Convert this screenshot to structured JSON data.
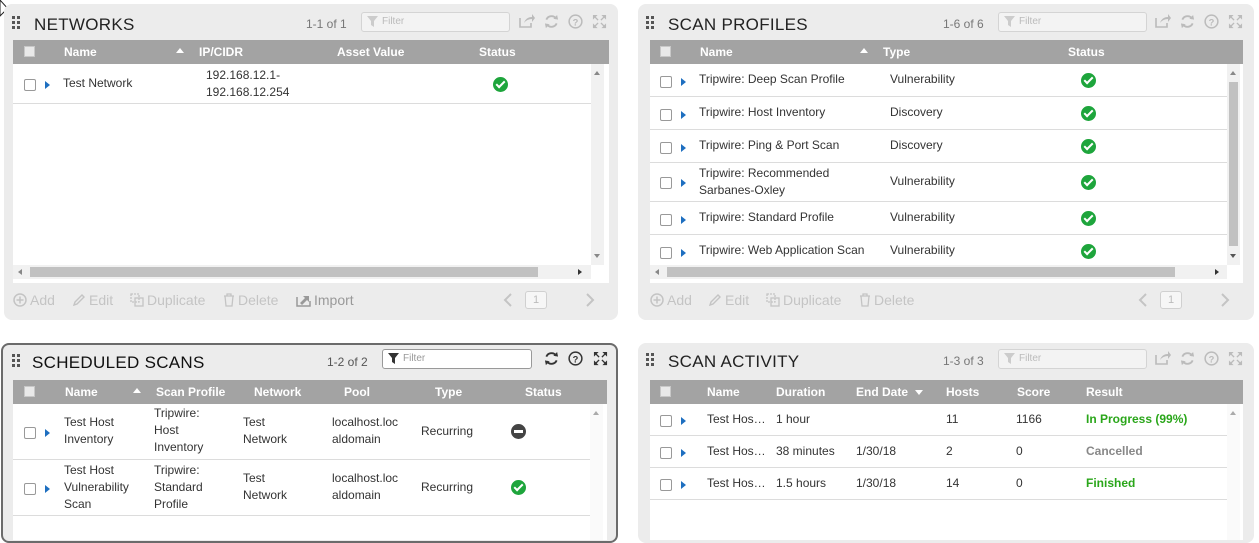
{
  "networks": {
    "title": "NETWORKS",
    "count": "1-1 of 1",
    "filter_placeholder": "Filter",
    "columns": [
      "Name",
      "IP/CIDR",
      "Asset Value",
      "Status"
    ],
    "rows": [
      {
        "name": "Test Network",
        "ip_line1": "192.168.12.1-",
        "ip_line2": "192.168.12.254",
        "asset_value": "",
        "status": "ok"
      }
    ],
    "footer": {
      "add": "Add",
      "edit": "Edit",
      "duplicate": "Duplicate",
      "delete": "Delete",
      "import": "Import"
    },
    "page": "1"
  },
  "scan_profiles": {
    "title": "SCAN PROFILES",
    "count": "1-6 of 6",
    "filter_placeholder": "Filter",
    "columns": [
      "Name",
      "Type",
      "Status"
    ],
    "rows": [
      {
        "name_line1": "Tripwire: Deep Scan Profile",
        "name_line2": "",
        "type": "Vulnerability",
        "status": "ok"
      },
      {
        "name_line1": "Tripwire: Host Inventory",
        "name_line2": "",
        "type": "Discovery",
        "status": "ok"
      },
      {
        "name_line1": "Tripwire: Ping & Port Scan",
        "name_line2": "",
        "type": "Discovery",
        "status": "ok"
      },
      {
        "name_line1": "Tripwire: Recommended",
        "name_line2": "Sarbanes-Oxley",
        "type": "Vulnerability",
        "status": "ok"
      },
      {
        "name_line1": "Tripwire: Standard Profile",
        "name_line2": "",
        "type": "Vulnerability",
        "status": "ok"
      },
      {
        "name_line1": "Tripwire: Web Application Scan",
        "name_line2": "",
        "type": "Vulnerability",
        "status": "ok"
      }
    ],
    "footer": {
      "add": "Add",
      "edit": "Edit",
      "duplicate": "Duplicate",
      "delete": "Delete"
    },
    "page": "1"
  },
  "scheduled_scans": {
    "title": "SCHEDULED SCANS",
    "count": "1-2 of 2",
    "filter_placeholder": "Filter",
    "columns": [
      "Name",
      "Scan Profile",
      "Network",
      "Pool",
      "Type",
      "Status"
    ],
    "rows": [
      {
        "name": [
          "Test Host",
          "Inventory"
        ],
        "profile": [
          "Tripwire:",
          "Host",
          "Inventory"
        ],
        "network": [
          "Test",
          "Network"
        ],
        "pool": [
          "localhost.loc",
          "aldomain"
        ],
        "type": "Recurring",
        "status": "stopped"
      },
      {
        "name": [
          "Test Host",
          "Vulnerability",
          "Scan"
        ],
        "profile": [
          "Tripwire:",
          "Standard",
          "Profile"
        ],
        "network": [
          "Test",
          "Network"
        ],
        "pool": [
          "localhost.loc",
          "aldomain"
        ],
        "type": "Recurring",
        "status": "ok"
      }
    ]
  },
  "scan_activity": {
    "title": "SCAN ACTIVITY",
    "count": "1-3 of 3",
    "filter_placeholder": "Filter",
    "columns": [
      "Name",
      "Duration",
      "End Date",
      "Hosts",
      "Score",
      "Result"
    ],
    "rows": [
      {
        "name": "Test Hos…",
        "duration": "1 hour",
        "end_date": "",
        "hosts": "11",
        "score": "1166",
        "result": "In Progress (99%)",
        "result_style": "green"
      },
      {
        "name": "Test Hos…",
        "duration": "38 minutes",
        "end_date": "1/30/18",
        "hosts": "2",
        "score": "0",
        "result": "Cancelled",
        "result_style": "gray"
      },
      {
        "name": "Test Hos…",
        "duration": "1.5 hours",
        "end_date": "1/30/18",
        "hosts": "14",
        "score": "0",
        "result": "Finished",
        "result_style": "green"
      }
    ]
  },
  "colors": {
    "accent_blue": "#1e6fc0",
    "status_green": "#1ea53c",
    "header_gray": "#a3a3a3"
  }
}
